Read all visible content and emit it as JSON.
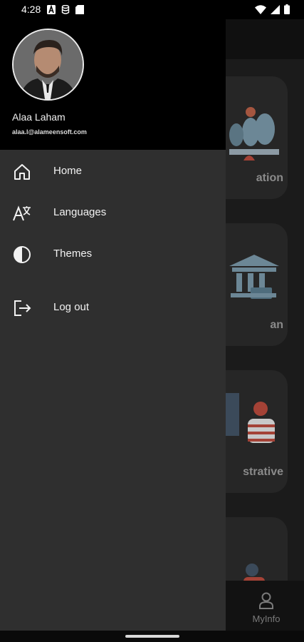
{
  "status_bar": {
    "time": "4:28"
  },
  "drawer": {
    "user": {
      "name": "Alaa Laham",
      "email": "alaa.l@alameensoft.com"
    },
    "menu": [
      {
        "label": "Home",
        "icon": "home-icon"
      },
      {
        "label": "Languages",
        "icon": "translate-icon"
      },
      {
        "label": "Themes",
        "icon": "theme-contrast-icon"
      },
      {
        "label": "Log out",
        "icon": "logout-icon"
      }
    ]
  },
  "background": {
    "cards": [
      {
        "label": "ation"
      },
      {
        "label": "an"
      },
      {
        "label": "strative"
      },
      {
        "label": ""
      }
    ],
    "bottom_nav": {
      "myinfo_label": "MyInfo"
    }
  },
  "colors": {
    "drawer_bg": "#2f2f2f",
    "drawer_header_bg": "#000000",
    "scrim_bg": "#1b1b1b"
  }
}
